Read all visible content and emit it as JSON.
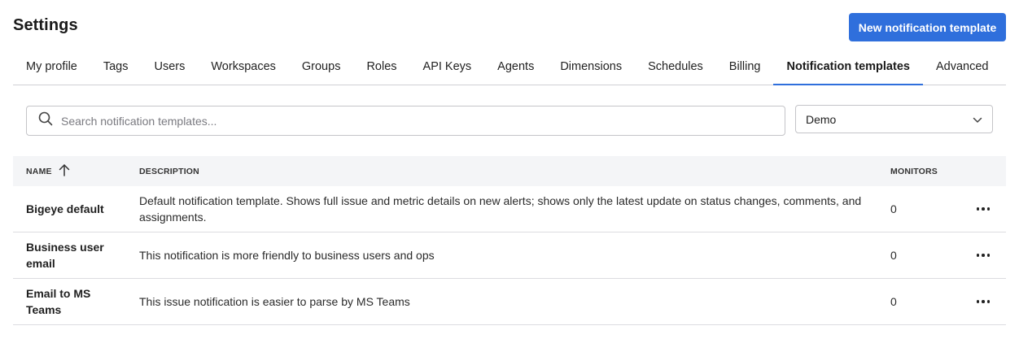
{
  "header": {
    "title": "Settings",
    "new_button_label": "New notification template"
  },
  "tabs": [
    {
      "label": "My profile",
      "active": false
    },
    {
      "label": "Tags",
      "active": false
    },
    {
      "label": "Users",
      "active": false
    },
    {
      "label": "Workspaces",
      "active": false
    },
    {
      "label": "Groups",
      "active": false
    },
    {
      "label": "Roles",
      "active": false
    },
    {
      "label": "API Keys",
      "active": false
    },
    {
      "label": "Agents",
      "active": false
    },
    {
      "label": "Dimensions",
      "active": false
    },
    {
      "label": "Schedules",
      "active": false
    },
    {
      "label": "Billing",
      "active": false
    },
    {
      "label": "Notification templates",
      "active": true
    },
    {
      "label": "Advanced",
      "active": false
    }
  ],
  "search": {
    "placeholder": "Search notification templates...",
    "value": "",
    "icon": "search-icon"
  },
  "workspace_select": {
    "selected": "Demo",
    "icon": "chevron-down-icon"
  },
  "table": {
    "columns": {
      "name": "NAME",
      "description": "DESCRIPTION",
      "monitors": "MONITORS"
    },
    "sort": {
      "column": "name",
      "direction": "ascending",
      "icon": "arrow-up-icon"
    },
    "rows": [
      {
        "name": "Bigeye default",
        "description": "Default notification template. Shows full issue and metric details on new alerts; shows only the latest update on status changes, comments, and assignments.",
        "monitors": "0"
      },
      {
        "name": "Business user email",
        "description": "This notification is more friendly to business users and ops",
        "monitors": "0"
      },
      {
        "name": "Email to MS Teams",
        "description": "This issue notification is easier to parse by MS Teams",
        "monitors": "0"
      }
    ],
    "row_action_icon": "more-horizontal-icon"
  },
  "colors": {
    "accent": "#2f6fdc",
    "header_bg": "#f4f5f7",
    "border": "#dcdce0"
  }
}
